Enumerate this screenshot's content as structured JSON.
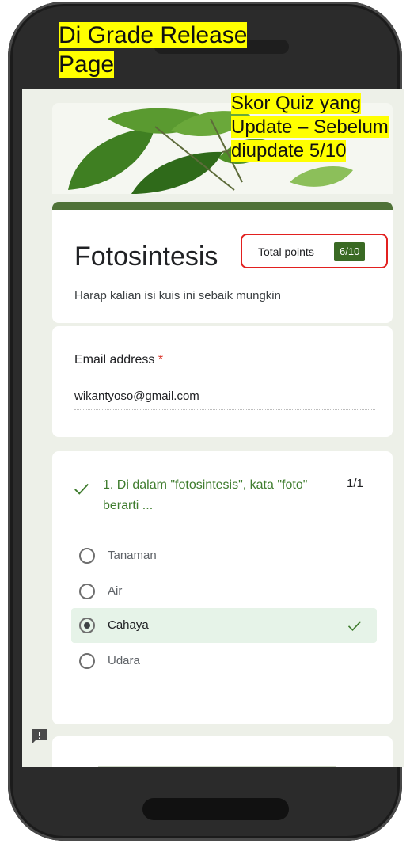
{
  "annotations": {
    "title_line1": "Di Grade Release",
    "title_line2": "Page",
    "score_line1": "Skor  Quiz yang",
    "score_line2": "Update – Sebelum",
    "score_line3": "diupdate 5/10"
  },
  "form": {
    "title": "Fotosintesis",
    "total_points_label": "Total points",
    "total_points_value": "6/10",
    "description": "Harap kalian isi kuis ini sebaik mungkin",
    "email": {
      "label": "Email address",
      "required_mark": "*",
      "value": "wikantyoso@gmail.com"
    },
    "question1": {
      "text": "1. Di dalam \"fotosintesis\", kata \"foto\" berarti ...",
      "score": "1/1",
      "options": [
        {
          "label": "Tanaman",
          "selected": false
        },
        {
          "label": "Air",
          "selected": false
        },
        {
          "label": "Cahaya",
          "selected": true
        },
        {
          "label": "Udara",
          "selected": false
        }
      ]
    }
  },
  "icons": {
    "check": "check-icon",
    "feedback": "feedback-icon"
  },
  "colors": {
    "accent": "#4f7238",
    "correct_text": "#3f7c2e",
    "points_badge": "#3a6a24",
    "highlight_box": "#e2201f",
    "annotation": "#ffff00"
  }
}
